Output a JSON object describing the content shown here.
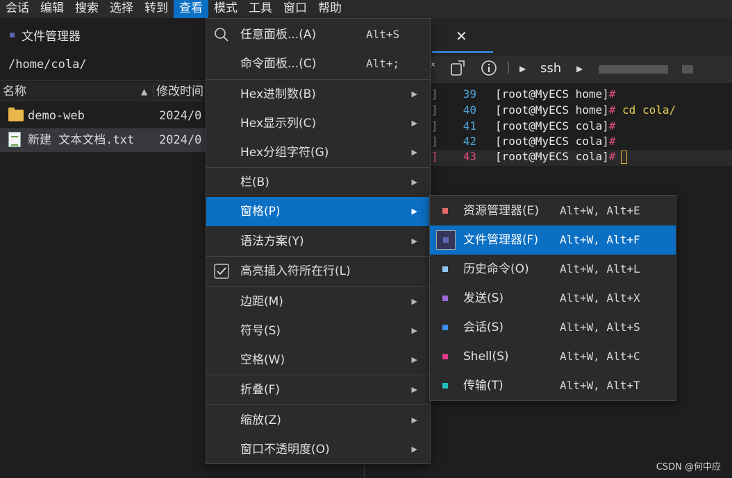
{
  "menubar": {
    "items": [
      "会话",
      "编辑",
      "搜索",
      "选择",
      "转到",
      "查看",
      "模式",
      "工具",
      "窗口",
      "帮助"
    ],
    "active_index": 5
  },
  "file_manager": {
    "title": "文件管理器",
    "path": "/home/cola/",
    "columns": [
      "名称",
      "修改时间"
    ],
    "rows": [
      {
        "name": "demo-web",
        "date": "2024/0",
        "type": "folder"
      },
      {
        "name": "新建 文本文档.txt",
        "date": "2024/0",
        "type": "text-file"
      }
    ]
  },
  "terminal": {
    "toolbar_label": "ssh",
    "lines": [
      {
        "num": "39",
        "prompt": "[root@MyECS home]",
        "hash": "#",
        "arg": ""
      },
      {
        "num": "40",
        "prompt": "[root@MyECS home]",
        "hash": "#",
        "arg": " cd cola/"
      },
      {
        "num": "41",
        "prompt": "[root@MyECS cola]",
        "hash": "#",
        "arg": ""
      },
      {
        "num": "42",
        "prompt": "[root@MyECS cola]",
        "hash": "#",
        "arg": ""
      },
      {
        "num": "43",
        "prompt": "[root@MyECS cola]",
        "hash": "#",
        "arg": ""
      }
    ]
  },
  "view_menu": {
    "items": [
      {
        "label": "任意面板...(A)",
        "shortcut": "Alt+S",
        "icon": "search-icon"
      },
      {
        "label": "命令面板...(C)",
        "shortcut": "Alt+;"
      },
      {
        "label": "Hex进制数(B)",
        "submenu": true
      },
      {
        "label": "Hex显示列(C)",
        "submenu": true
      },
      {
        "label": "Hex分组字符(G)",
        "submenu": true
      },
      {
        "label": "栏(B)",
        "submenu": true
      },
      {
        "label": "窗格(P)",
        "submenu": true,
        "highlighted": true
      },
      {
        "label": "语法方案(Y)",
        "submenu": true
      },
      {
        "label": "高亮插入符所在行(L)",
        "checked": true,
        "icon": "checkbox-icon"
      },
      {
        "label": "边距(M)",
        "submenu": true
      },
      {
        "label": "符号(S)",
        "submenu": true
      },
      {
        "label": "空格(W)",
        "submenu": true
      },
      {
        "label": "折叠(F)",
        "submenu": true
      },
      {
        "label": "缩放(Z)",
        "submenu": true
      },
      {
        "label": "窗口不透明度(O)",
        "submenu": true
      }
    ]
  },
  "pane_submenu": {
    "items": [
      {
        "label": "资源管理器(E)",
        "shortcut": "Alt+W, Alt+E",
        "color": "#e26a6a"
      },
      {
        "label": "文件管理器(F)",
        "shortcut": "Alt+W, Alt+F",
        "color": "#5c63b0",
        "highlighted": true
      },
      {
        "label": "历史命令(O)",
        "shortcut": "Alt+W, Alt+L",
        "color": "#8fc8f0"
      },
      {
        "label": "发送(S)",
        "shortcut": "Alt+W, Alt+X",
        "color": "#9a6ad8"
      },
      {
        "label": "会话(S)",
        "shortcut": "Alt+W, Alt+S",
        "color": "#3a8ef0"
      },
      {
        "label": "Shell(S)",
        "shortcut": "Alt+W, Alt+C",
        "color": "#e23c8a"
      },
      {
        "label": "传输(T)",
        "shortcut": "Alt+W, Alt+T",
        "color": "#20c0b8"
      }
    ]
  },
  "watermark": "CSDN @何中应"
}
